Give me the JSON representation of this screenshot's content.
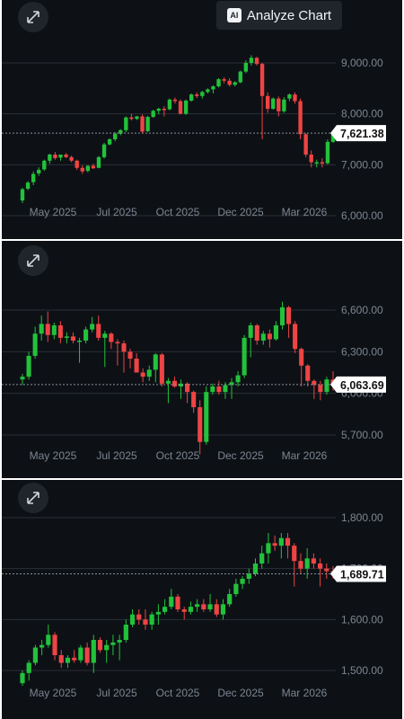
{
  "analyze_button": {
    "label": "Analyze Chart",
    "icon": "ai-icon",
    "badge": "AI"
  },
  "colors": {
    "background": "#0d1116",
    "up": "#22c23a",
    "down": "#ef4444",
    "grid": "#2a2f36",
    "tick_text": "#7d8590",
    "badge_bg": "#ffffff"
  },
  "chart_data": [
    {
      "type": "candlestick",
      "x_ticks": [
        "May 2025",
        "Jul 2025",
        "Oct 2025",
        "Dec 2025",
        "Mar 2026"
      ],
      "y_ticks": [
        "9,000.00",
        "8,000.00",
        "7,000.00",
        "6,000.00"
      ],
      "ylim": [
        6000,
        9000
      ],
      "current_price": "7,621.38",
      "current_value": 7621.38,
      "grid": true,
      "candles": [
        [
          6300,
          6550,
          6250,
          6520
        ],
        [
          6530,
          6680,
          6500,
          6650
        ],
        [
          6660,
          6870,
          6600,
          6820
        ],
        [
          6830,
          6950,
          6780,
          6900
        ],
        [
          6910,
          7100,
          6880,
          7080
        ],
        [
          7080,
          7220,
          7020,
          7200
        ],
        [
          7200,
          7250,
          7100,
          7130
        ],
        [
          7140,
          7200,
          7080,
          7200
        ],
        [
          7200,
          7230,
          7130,
          7150
        ],
        [
          7150,
          7180,
          7050,
          7080
        ],
        [
          7080,
          7100,
          6900,
          6940
        ],
        [
          6940,
          6990,
          6820,
          6870
        ],
        [
          6880,
          6990,
          6850,
          6980
        ],
        [
          6980,
          7020,
          6920,
          6930
        ],
        [
          6940,
          7170,
          6930,
          7150
        ],
        [
          7150,
          7430,
          7120,
          7400
        ],
        [
          7400,
          7520,
          7380,
          7500
        ],
        [
          7500,
          7640,
          7460,
          7610
        ],
        [
          7610,
          7700,
          7580,
          7680
        ],
        [
          7680,
          7950,
          7640,
          7930
        ],
        [
          7930,
          8000,
          7870,
          7900
        ],
        [
          7900,
          7960,
          7880,
          7950
        ],
        [
          7950,
          7990,
          7620,
          7650
        ],
        [
          7660,
          7960,
          7640,
          7940
        ],
        [
          7940,
          8080,
          7920,
          8060
        ],
        [
          8060,
          8120,
          7990,
          8100
        ],
        [
          8100,
          8150,
          7950,
          8090
        ],
        [
          8090,
          8300,
          8070,
          8280
        ],
        [
          8280,
          8320,
          8200,
          8250
        ],
        [
          8250,
          8280,
          7990,
          8000
        ],
        [
          8000,
          8280,
          7980,
          8260
        ],
        [
          8260,
          8400,
          8240,
          8380
        ],
        [
          8380,
          8420,
          8310,
          8350
        ],
        [
          8350,
          8450,
          8300,
          8430
        ],
        [
          8430,
          8500,
          8400,
          8480
        ],
        [
          8480,
          8560,
          8400,
          8540
        ],
        [
          8540,
          8700,
          8520,
          8680
        ],
        [
          8680,
          8720,
          8600,
          8650
        ],
        [
          8650,
          8700,
          8540,
          8570
        ],
        [
          8570,
          8640,
          8540,
          8620
        ],
        [
          8620,
          8850,
          8600,
          8830
        ],
        [
          8830,
          9050,
          8800,
          9000
        ],
        [
          9000,
          9150,
          8950,
          9100
        ],
        [
          9100,
          9120,
          8950,
          8980
        ],
        [
          8980,
          9000,
          7500,
          8350
        ],
        [
          8350,
          8420,
          8020,
          8100
        ],
        [
          8100,
          8320,
          8080,
          8300
        ],
        [
          8300,
          8340,
          7950,
          8050
        ],
        [
          8050,
          8330,
          8020,
          8280
        ],
        [
          8300,
          8400,
          8250,
          8380
        ],
        [
          8380,
          8420,
          8200,
          8250
        ],
        [
          8250,
          8300,
          7500,
          7600
        ],
        [
          7600,
          7620,
          7150,
          7200
        ],
        [
          7200,
          7280,
          6950,
          7050
        ],
        [
          7050,
          7100,
          6950,
          7050
        ],
        [
          7050,
          7130,
          6950,
          7030
        ],
        [
          7030,
          7500,
          7010,
          7450
        ],
        [
          7450,
          7660,
          7430,
          7620
        ]
      ]
    },
    {
      "type": "candlestick",
      "x_ticks": [
        "May 2025",
        "Jul 2025",
        "Oct 2025",
        "Dec 2025",
        "Mar 2026"
      ],
      "y_ticks": [
        "6,600.00",
        "6,300.00",
        "6,000.00",
        "5,700.00"
      ],
      "ylim": [
        5700,
        6600
      ],
      "current_price": "6,063.69",
      "current_value": 6063.69,
      "grid": true,
      "candles": [
        [
          6100,
          6140,
          6060,
          6120
        ],
        [
          6120,
          6300,
          6100,
          6270
        ],
        [
          6270,
          6480,
          6250,
          6430
        ],
        [
          6430,
          6560,
          6380,
          6500
        ],
        [
          6500,
          6590,
          6370,
          6420
        ],
        [
          6420,
          6510,
          6390,
          6490
        ],
        [
          6490,
          6520,
          6360,
          6400
        ],
        [
          6400,
          6440,
          6360,
          6410
        ],
        [
          6410,
          6440,
          6360,
          6380
        ],
        [
          6380,
          6400,
          6220,
          6380
        ],
        [
          6380,
          6480,
          6360,
          6460
        ],
        [
          6460,
          6550,
          6440,
          6500
        ],
        [
          6500,
          6560,
          6380,
          6400
        ],
        [
          6400,
          6450,
          6190,
          6430
        ],
        [
          6430,
          6440,
          6320,
          6370
        ],
        [
          6370,
          6390,
          6200,
          6360
        ],
        [
          6360,
          6380,
          6150,
          6300
        ],
        [
          6300,
          6320,
          6180,
          6250
        ],
        [
          6250,
          6290,
          6150,
          6150
        ],
        [
          6150,
          6180,
          6080,
          6120
        ],
        [
          6120,
          6200,
          6090,
          6170
        ],
        [
          6170,
          6290,
          6080,
          6280
        ],
        [
          6280,
          6290,
          6050,
          6070
        ],
        [
          6070,
          6110,
          5930,
          6090
        ],
        [
          6090,
          6120,
          6040,
          6050
        ],
        [
          6050,
          6100,
          5960,
          6070
        ],
        [
          6070,
          6080,
          5930,
          6010
        ],
        [
          6010,
          6020,
          5860,
          5900
        ],
        [
          5900,
          5950,
          5560,
          5650
        ],
        [
          5650,
          6050,
          5630,
          6010
        ],
        [
          6010,
          6070,
          5990,
          6050
        ],
        [
          6050,
          6090,
          5990,
          6010
        ],
        [
          6010,
          6080,
          5960,
          6060
        ],
        [
          6060,
          6110,
          5960,
          6080
        ],
        [
          6080,
          6160,
          6050,
          6130
        ],
        [
          6130,
          6420,
          6110,
          6400
        ],
        [
          6400,
          6510,
          6260,
          6490
        ],
        [
          6490,
          6500,
          6350,
          6380
        ],
        [
          6380,
          6450,
          6350,
          6430
        ],
        [
          6430,
          6460,
          6330,
          6390
        ],
        [
          6390,
          6520,
          6380,
          6490
        ],
        [
          6490,
          6660,
          6460,
          6620
        ],
        [
          6620,
          6630,
          6400,
          6500
        ],
        [
          6500,
          6520,
          6290,
          6320
        ],
        [
          6320,
          6330,
          6050,
          6200
        ],
        [
          6200,
          6210,
          6050,
          6090
        ],
        [
          6090,
          6100,
          5960,
          6060
        ],
        [
          6060,
          6090,
          5950,
          6010
        ],
        [
          6010,
          6120,
          5990,
          6100
        ],
        [
          6100,
          6160,
          6020,
          6063
        ]
      ]
    },
    {
      "type": "candlestick",
      "x_ticks": [
        "May 2025",
        "Jul 2025",
        "Oct 2025",
        "Dec 2025",
        "Mar 2026"
      ],
      "y_ticks": [
        "1,800.00",
        "1,700.00",
        "1,600.00",
        "1,500.00"
      ],
      "ylim": [
        1500,
        1800
      ],
      "current_price": "1,689.71",
      "current_value": 1689.71,
      "grid": true,
      "candles": [
        [
          1475,
          1500,
          1470,
          1495
        ],
        [
          1495,
          1520,
          1480,
          1515
        ],
        [
          1515,
          1550,
          1510,
          1545
        ],
        [
          1545,
          1560,
          1530,
          1550
        ],
        [
          1550,
          1590,
          1545,
          1570
        ],
        [
          1570,
          1575,
          1520,
          1530
        ],
        [
          1530,
          1540,
          1505,
          1515
        ],
        [
          1515,
          1530,
          1505,
          1525
        ],
        [
          1525,
          1540,
          1515,
          1520
        ],
        [
          1520,
          1550,
          1515,
          1545
        ],
        [
          1545,
          1555,
          1510,
          1515
        ],
        [
          1515,
          1570,
          1495,
          1560
        ],
        [
          1560,
          1565,
          1535,
          1540
        ],
        [
          1540,
          1560,
          1515,
          1550
        ],
        [
          1550,
          1570,
          1530,
          1555
        ],
        [
          1555,
          1570,
          1520,
          1560
        ],
        [
          1560,
          1600,
          1555,
          1590
        ],
        [
          1590,
          1620,
          1585,
          1610
        ],
        [
          1610,
          1620,
          1590,
          1600
        ],
        [
          1600,
          1620,
          1580,
          1590
        ],
        [
          1590,
          1615,
          1580,
          1610
        ],
        [
          1610,
          1630,
          1590,
          1615
        ],
        [
          1615,
          1640,
          1610,
          1625
        ],
        [
          1625,
          1660,
          1620,
          1645
        ],
        [
          1645,
          1650,
          1615,
          1620
        ],
        [
          1620,
          1625,
          1600,
          1615
        ],
        [
          1615,
          1635,
          1610,
          1625
        ],
        [
          1625,
          1640,
          1615,
          1630
        ],
        [
          1630,
          1640,
          1615,
          1620
        ],
        [
          1620,
          1650,
          1615,
          1630
        ],
        [
          1630,
          1640,
          1605,
          1610
        ],
        [
          1610,
          1640,
          1600,
          1630
        ],
        [
          1630,
          1660,
          1625,
          1650
        ],
        [
          1650,
          1680,
          1645,
          1670
        ],
        [
          1670,
          1685,
          1660,
          1680
        ],
        [
          1680,
          1700,
          1670,
          1690
        ],
        [
          1690,
          1720,
          1685,
          1710
        ],
        [
          1710,
          1745,
          1700,
          1730
        ],
        [
          1730,
          1770,
          1710,
          1750
        ],
        [
          1750,
          1765,
          1735,
          1745
        ],
        [
          1745,
          1770,
          1720,
          1760
        ],
        [
          1760,
          1770,
          1720,
          1745
        ],
        [
          1745,
          1750,
          1665,
          1715
        ],
        [
          1715,
          1730,
          1690,
          1700
        ],
        [
          1700,
          1740,
          1680,
          1720
        ],
        [
          1720,
          1730,
          1700,
          1710
        ],
        [
          1710,
          1720,
          1665,
          1700
        ],
        [
          1700,
          1710,
          1680,
          1695
        ],
        [
          1695,
          1705,
          1680,
          1690
        ]
      ]
    }
  ]
}
